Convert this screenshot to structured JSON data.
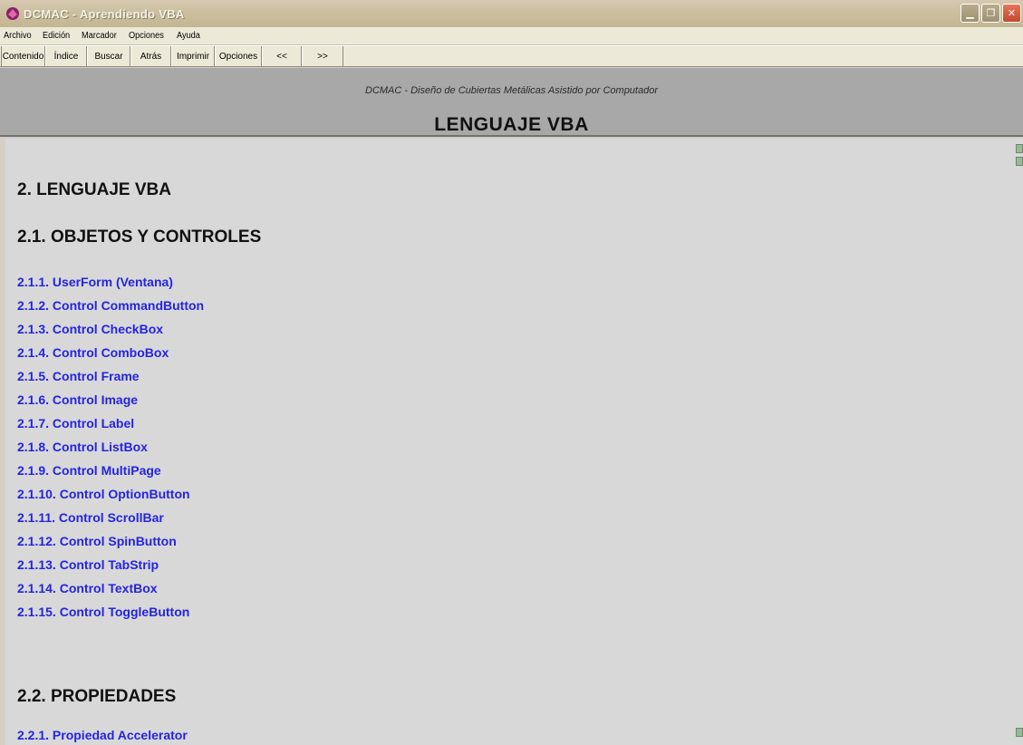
{
  "window": {
    "title": "DCMAC - Aprendiendo VBA"
  },
  "menu": [
    "Archivo",
    "Edición",
    "Marcador",
    "Opciones",
    "Ayuda"
  ],
  "toolbar": [
    "Contenido",
    "Índice",
    "Buscar",
    "Atrás",
    "Imprimir",
    "Opciones",
    "<<",
    ">>"
  ],
  "header": {
    "subtitle": "DCMAC - Diseño de Cubiertas Metálicas Asistido por Computador",
    "title": "LENGUAJE VBA"
  },
  "content": {
    "section_title": "2.  LENGUAJE VBA",
    "subsection1": "2.1. OBJETOS Y CONTROLES",
    "links1": [
      "2.1.1.  UserForm (Ventana)",
      "2.1.2.  Control CommandButton",
      "2.1.3.  Control CheckBox",
      "2.1.4.  Control ComboBox",
      "2.1.5.  Control Frame",
      "2.1.6.  Control Image",
      "2.1.7.  Control Label",
      "2.1.8.  Control ListBox",
      "2.1.9.  Control MultiPage",
      "2.1.10. Control OptionButton",
      "2.1.11. Control ScrollBar",
      "2.1.12. Control SpinButton",
      "2.1.13. Control TabStrip",
      "2.1.14. Control TextBox",
      "2.1.15. Control ToggleButton"
    ],
    "subsection2": "2.2. PROPIEDADES",
    "links2": [
      "2.2.1.  Propiedad Accelerator"
    ]
  },
  "colors": {
    "link": "#2424e0",
    "header_band": "#a8a8a8",
    "content_bg": "#d8d8d8"
  }
}
